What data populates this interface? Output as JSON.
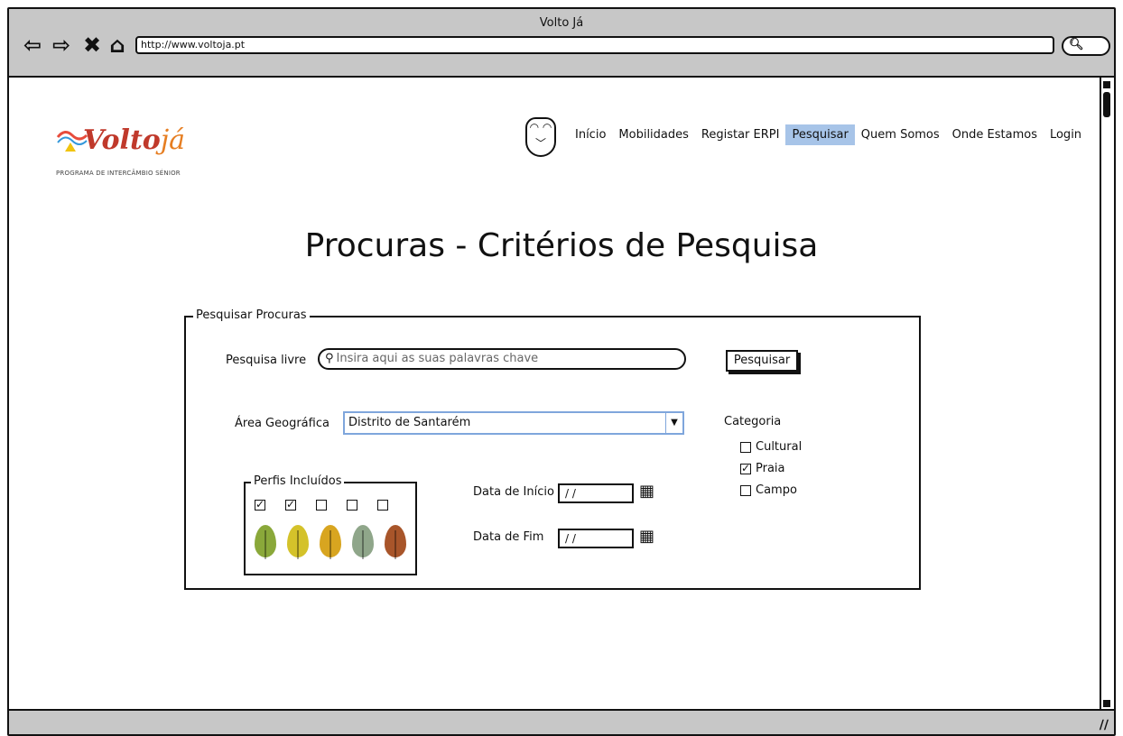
{
  "window": {
    "title": "Volto Já",
    "url": "http://www.voltoja.pt"
  },
  "logo": {
    "word_main": "olto",
    "word_accent": "já",
    "word_prefix": "V",
    "subtitle": "PROGRAMA DE INTERCÂMBIO SÉNIOR"
  },
  "menu": {
    "items": [
      {
        "label": "Início",
        "active": false
      },
      {
        "label": "Mobilidades",
        "active": false
      },
      {
        "label": "Registar ERPI",
        "active": false
      },
      {
        "label": "Pesquisar",
        "active": true
      },
      {
        "label": "Quem Somos",
        "active": false
      },
      {
        "label": "Onde Estamos",
        "active": false
      },
      {
        "label": "Login",
        "active": false
      }
    ]
  },
  "page": {
    "title": "Procuras - Critérios de Pesquisa"
  },
  "form": {
    "legend": "Pesquisar Procuras",
    "free_search_label": "Pesquisa livre",
    "free_search_placeholder": "Insira aqui as suas palavras chave",
    "search_button": "Pesquisar",
    "geo_label": "Área Geográfica",
    "geo_value": "Distrito de Santarém",
    "category_label": "Categoria",
    "categories": [
      {
        "label": "Cultural",
        "checked": false
      },
      {
        "label": "Praia",
        "checked": true
      },
      {
        "label": "Campo",
        "checked": false
      }
    ],
    "profiles_legend": "Perfis Incluídos",
    "profiles": [
      {
        "checked": true,
        "color": "#8aa83a"
      },
      {
        "checked": true,
        "color": "#d4c22a"
      },
      {
        "checked": false,
        "color": "#d8a520"
      },
      {
        "checked": false,
        "color": "#8fa68a"
      },
      {
        "checked": false,
        "color": "#a8552a"
      }
    ],
    "start_date_label": "Data de Início",
    "start_date_value": "/ /",
    "end_date_label": "Data de Fim",
    "end_date_value": "/ /"
  }
}
